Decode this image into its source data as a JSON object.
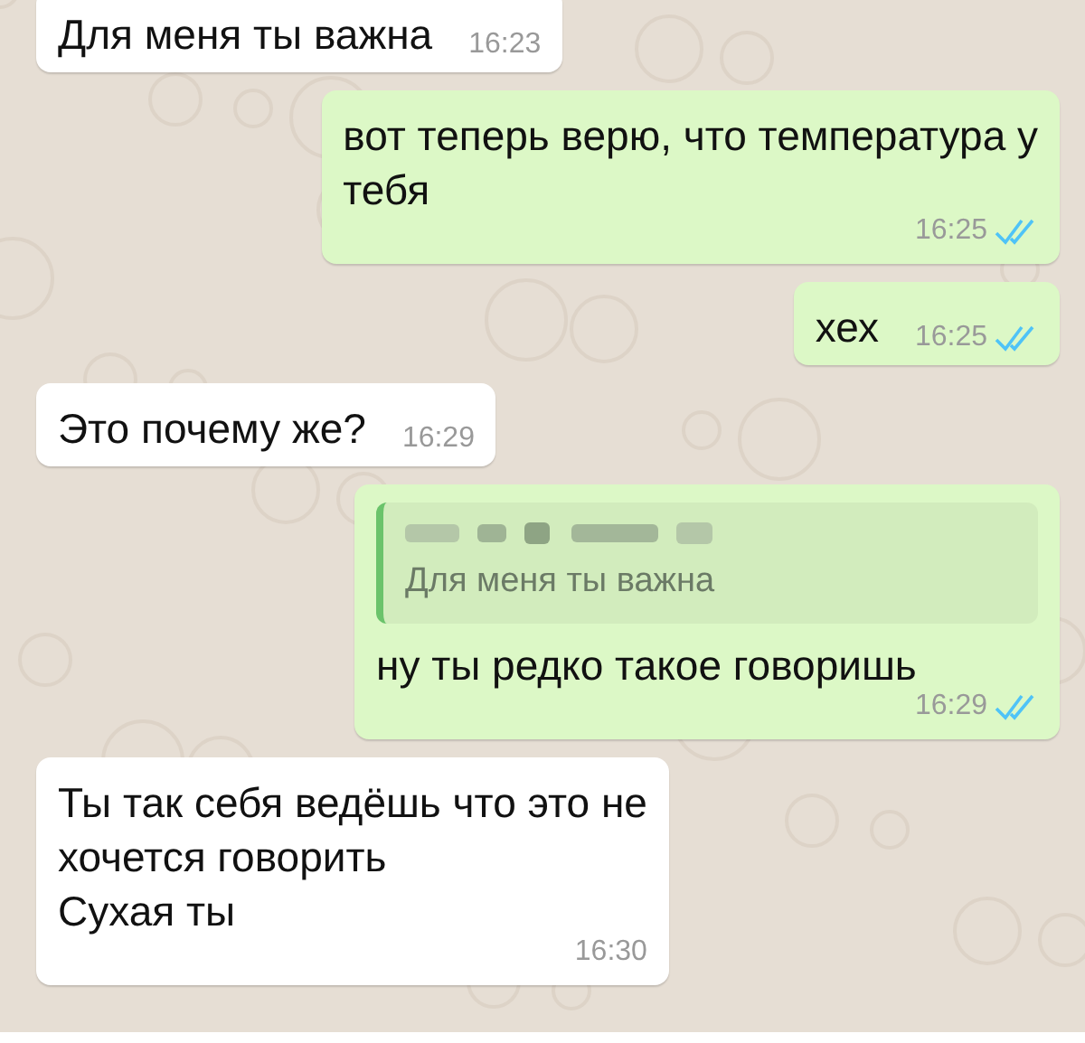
{
  "messages": [
    {
      "kind": "incoming",
      "text": "Для меня ты важна",
      "time": "16:23"
    },
    {
      "kind": "outgoing",
      "text": "вот теперь верю, что температура у\nтебя",
      "time": "16:25",
      "read": true
    },
    {
      "kind": "outgoing",
      "text": "хех",
      "time": "16:25",
      "read": true
    },
    {
      "kind": "incoming",
      "text": "Это почему же?",
      "time": "16:29"
    },
    {
      "kind": "outgoing",
      "quote": {
        "text": "Для меня ты важна"
      },
      "text": "ну ты редко такое говоришь",
      "time": "16:29",
      "read": true
    },
    {
      "kind": "incoming",
      "text": "Ты так себя ведёшь что это не\nхочется говорить\nСухая ты",
      "time": "16:30"
    }
  ]
}
